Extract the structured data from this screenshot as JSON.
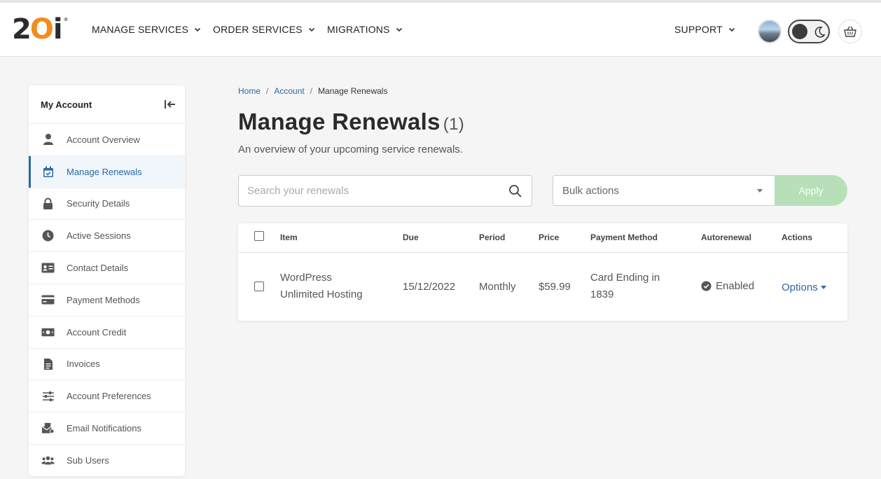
{
  "brand": {
    "logo_part1": "2",
    "logo_part2": "O",
    "logo_part3": "i",
    "logo_mark": "®",
    "accent_color": "#f28c1e"
  },
  "nav": {
    "items": [
      {
        "label": "MANAGE SERVICES"
      },
      {
        "label": "ORDER SERVICES"
      },
      {
        "label": "MIGRATIONS"
      },
      {
        "label": "SUPPORT"
      }
    ]
  },
  "sidebar": {
    "title": "My Account",
    "items": [
      {
        "label": "Account Overview",
        "icon": "user-icon"
      },
      {
        "label": "Manage Renewals",
        "icon": "calendar-check-icon",
        "active": true
      },
      {
        "label": "Security Details",
        "icon": "lock-icon"
      },
      {
        "label": "Active Sessions",
        "icon": "clock-icon"
      },
      {
        "label": "Contact Details",
        "icon": "id-card-icon"
      },
      {
        "label": "Payment Methods",
        "icon": "credit-card-icon"
      },
      {
        "label": "Account Credit",
        "icon": "money-icon"
      },
      {
        "label": "Invoices",
        "icon": "document-icon"
      },
      {
        "label": "Account Preferences",
        "icon": "sliders-icon"
      },
      {
        "label": "Email Notifications",
        "icon": "email-notification-icon"
      },
      {
        "label": "Sub Users",
        "icon": "users-icon"
      }
    ]
  },
  "breadcrumb": {
    "home": "Home",
    "account": "Account",
    "current": "Manage Renewals",
    "separator": "/"
  },
  "page": {
    "title": "Manage Renewals",
    "count": "(1)",
    "subtitle": "An overview of your upcoming service renewals."
  },
  "search": {
    "placeholder": "Search your renewals",
    "value": ""
  },
  "bulk": {
    "label": "Bulk actions",
    "apply_label": "Apply",
    "apply_color": "#b7e0b9"
  },
  "table": {
    "headers": {
      "item": "Item",
      "due": "Due",
      "period": "Period",
      "price": "Price",
      "payment": "Payment Method",
      "autorenewal": "Autorenewal",
      "actions": "Actions"
    },
    "rows": [
      {
        "item_line1": "WordPress",
        "item_line2": "Unlimited Hosting",
        "due": "15/12/2022",
        "period": "Monthly",
        "price": "$59.99",
        "payment_line1": "Card Ending in",
        "payment_line2": "1839",
        "autorenewal": "Enabled",
        "action": "Options"
      }
    ]
  },
  "colors": {
    "link": "#2a67a8",
    "active_bg": "#f1f6fb"
  }
}
